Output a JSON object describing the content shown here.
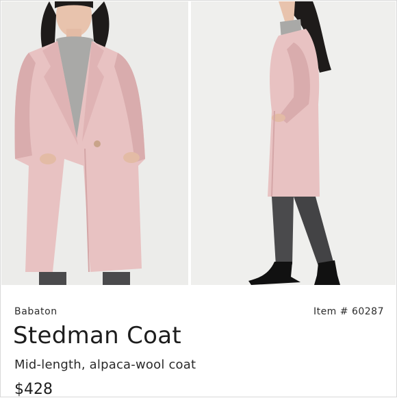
{
  "product": {
    "brand": "Babaton",
    "item_number": "Item # 60287",
    "name": "Stedman Coat",
    "description": "Mid-length, alpaca-wool coat",
    "price": "$428"
  },
  "images": [
    {
      "name": "front-view",
      "icon": "product-photo-front"
    },
    {
      "name": "side-view",
      "icon": "product-photo-side"
    }
  ],
  "colors": {
    "coat": "#e8c2c2",
    "coat_shadow": "#d9acad",
    "sweater": "#a9a9a7",
    "hair": "#1e1b1a",
    "skin": "#e8c3ad",
    "trousers": "#4a4a4c",
    "boots": "#111111",
    "background": "#ececea"
  }
}
